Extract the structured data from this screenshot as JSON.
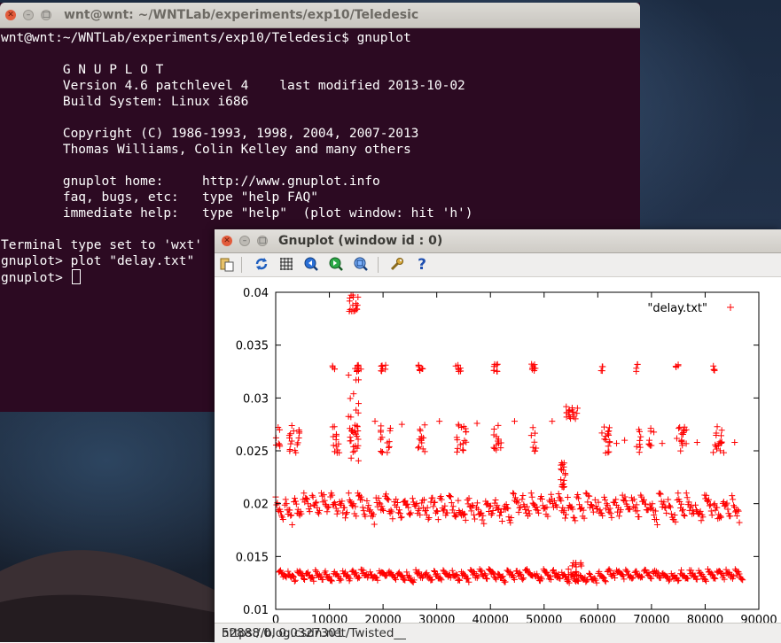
{
  "terminal": {
    "title": "wnt@wnt: ~/WNTLab/experiments/exp10/Teledesic",
    "lines": [
      "wnt@wnt:~/WNTLab/experiments/exp10/Teledesic$ gnuplot",
      "",
      "        G N U P L O T",
      "        Version 4.6 patchlevel 4    last modified 2013-10-02",
      "        Build System: Linux i686",
      "",
      "        Copyright (C) 1986-1993, 1998, 2004, 2007-2013",
      "        Thomas Williams, Colin Kelley and many others",
      "",
      "        gnuplot home:     http://www.gnuplot.info",
      "        faq, bugs, etc:   type \"help FAQ\"",
      "        immediate help:   type \"help\"  (plot window: hit 'h')",
      "",
      "Terminal type set to 'wxt'",
      "gnuplot> plot \"delay.txt\"",
      "gnuplot> "
    ]
  },
  "gnuplot_window": {
    "title": "Gnuplot (window id : 0)",
    "status": "52888.0,  0.0327301",
    "watermark": "https://blog.csdn.net/Twisted__",
    "toolbar": {
      "copy_icon": "clipboard-copy-icon",
      "replot_icon": "replot-icon",
      "grid_icon": "grid-icon",
      "zoom_prev_icon": "zoom-previous-icon",
      "zoom_next_icon": "zoom-next-icon",
      "autoscale_icon": "autoscale-icon",
      "config_icon": "wrench-icon",
      "help_icon": "help-icon"
    }
  },
  "chart_data": {
    "type": "scatter",
    "legend": "\"delay.txt\"",
    "legend_position": "top-right",
    "marker": "+",
    "color": "#ff0000",
    "xlim": [
      0,
      90000
    ],
    "ylim": [
      0.01,
      0.04
    ],
    "x_ticks": [
      "0",
      "10000",
      "20000",
      "30000",
      "40000",
      "50000",
      "60000",
      "70000",
      "80000",
      "90000"
    ],
    "y_ticks": [
      "0.01",
      "0.015",
      "0.02",
      "0.025",
      "0.03",
      "0.035",
      "0.04"
    ],
    "grid": false,
    "bands": [
      {
        "y_min": 0.0125,
        "y_max": 0.0138,
        "x_ranges": [
          [
            600,
            86000
          ]
        ]
      },
      {
        "y_min": 0.018,
        "y_max": 0.021,
        "x_ranges": [
          [
            0,
            86000
          ]
        ]
      },
      {
        "y_min": 0.0248,
        "y_max": 0.0275,
        "x_ranges": [
          [
            0,
            800
          ],
          [
            2500,
            4500
          ],
          [
            10500,
            12000
          ],
          [
            13500,
            15500
          ],
          [
            19500,
            21500
          ],
          [
            26500,
            28000
          ],
          [
            33500,
            35500
          ],
          [
            40500,
            42000
          ],
          [
            47500,
            48500
          ],
          [
            60500,
            62500
          ],
          [
            67000,
            68000
          ],
          [
            69500,
            70500
          ],
          [
            74500,
            76500
          ],
          [
            81500,
            83500
          ]
        ]
      },
      {
        "y_min": 0.0325,
        "y_max": 0.0332,
        "x_ranges": [
          [
            10500,
            11000
          ],
          [
            15000,
            16000
          ],
          [
            19500,
            20500
          ],
          [
            26500,
            27500
          ],
          [
            33500,
            34500
          ],
          [
            40500,
            41500
          ],
          [
            47500,
            48500
          ],
          [
            60500,
            61000
          ],
          [
            67000,
            67500
          ],
          [
            74500,
            75000
          ],
          [
            81500,
            82000
          ]
        ]
      },
      {
        "y_min": 0.0382,
        "y_max": 0.0398,
        "x_ranges": [
          [
            13500,
            15500
          ]
        ]
      }
    ],
    "spikes": [
      {
        "x_range": [
          13500,
          15500
        ],
        "y_min": 0.023,
        "y_max": 0.0335
      },
      {
        "x_range": [
          53000,
          54000
        ],
        "y_min": 0.0215,
        "y_max": 0.024
      },
      {
        "x_range": [
          54000,
          56500
        ],
        "y_min": 0.028,
        "y_max": 0.0292
      },
      {
        "x_range": [
          54500,
          57000
        ],
        "y_min": 0.0128,
        "y_max": 0.0145
      }
    ],
    "sparse_points": [
      {
        "x": 18500,
        "y": 0.0278
      },
      {
        "x": 23500,
        "y": 0.0275
      },
      {
        "x": 30500,
        "y": 0.0278
      },
      {
        "x": 37500,
        "y": 0.0276
      },
      {
        "x": 44500,
        "y": 0.0278
      },
      {
        "x": 51500,
        "y": 0.0278
      },
      {
        "x": 63500,
        "y": 0.0257
      },
      {
        "x": 65000,
        "y": 0.026
      },
      {
        "x": 72000,
        "y": 0.0257
      },
      {
        "x": 78500,
        "y": 0.0258
      },
      {
        "x": 85500,
        "y": 0.0258
      }
    ]
  }
}
